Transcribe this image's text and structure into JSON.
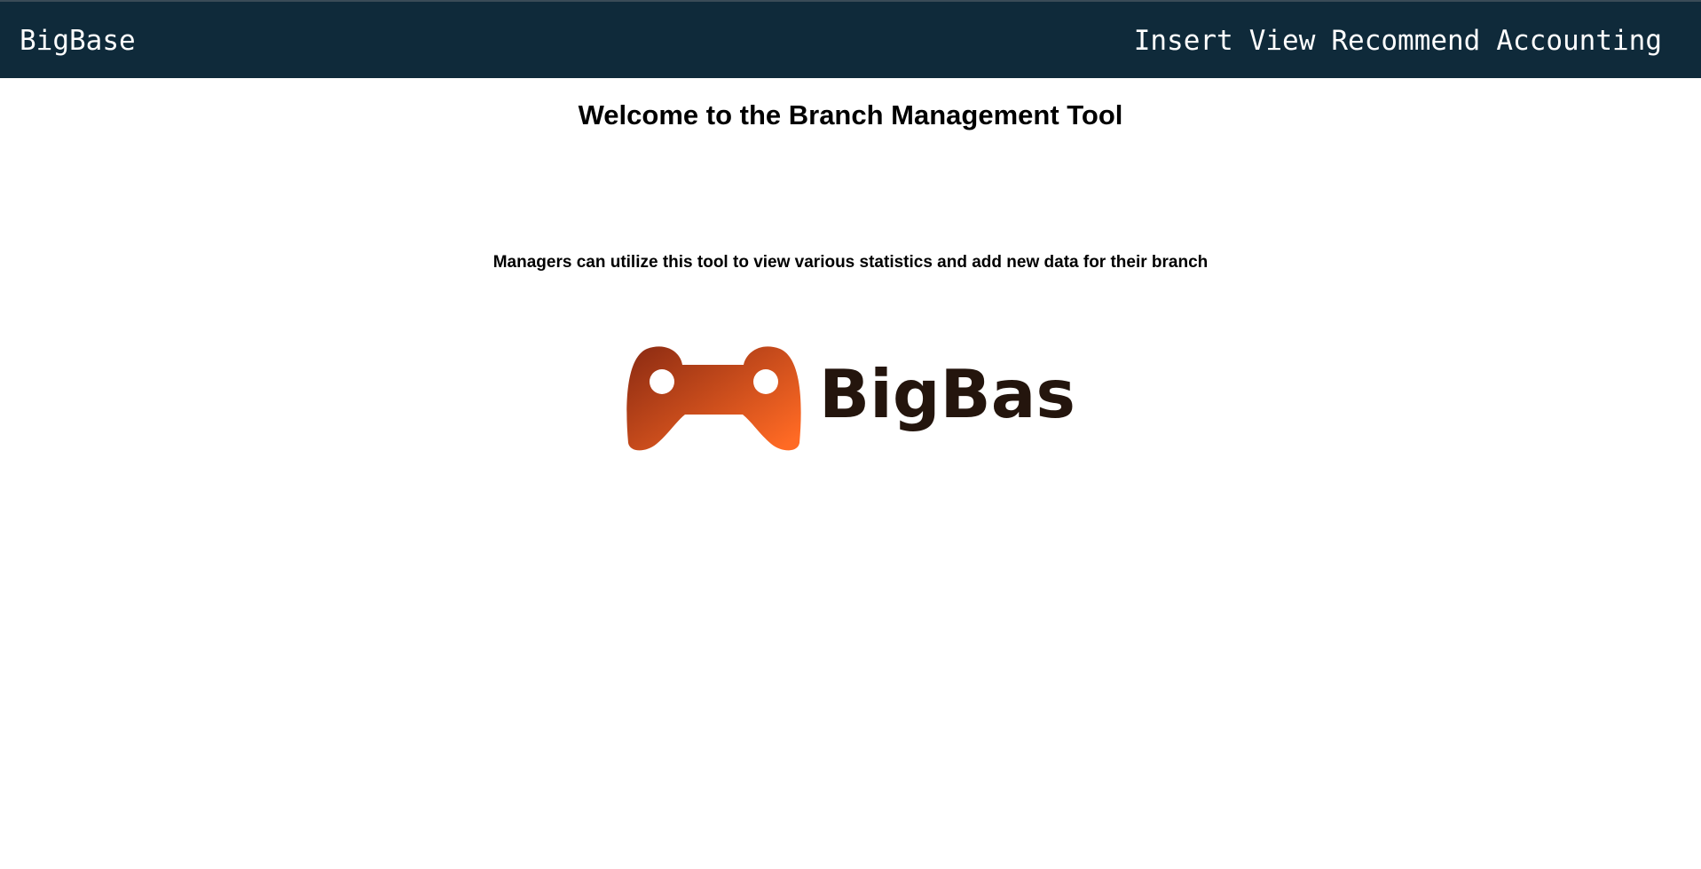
{
  "navbar": {
    "brand": "BigBase",
    "links": [
      {
        "label": "Insert"
      },
      {
        "label": "View"
      },
      {
        "label": "Recommend"
      },
      {
        "label": "Accounting"
      }
    ]
  },
  "main": {
    "title": "Welcome to the Branch Management Tool",
    "description": "Managers can utilize this tool to view various statistics and add new data for their branch"
  },
  "logo": {
    "text": "BigBase",
    "icon": "game-controller-icon",
    "gradient_start": "#8a2a12",
    "gradient_end": "#ff6a24",
    "text_color": "#24150d"
  },
  "colors": {
    "navbar_background": "#0f2a3a",
    "navbar_text": "#ffffff",
    "page_background": "#ffffff"
  }
}
